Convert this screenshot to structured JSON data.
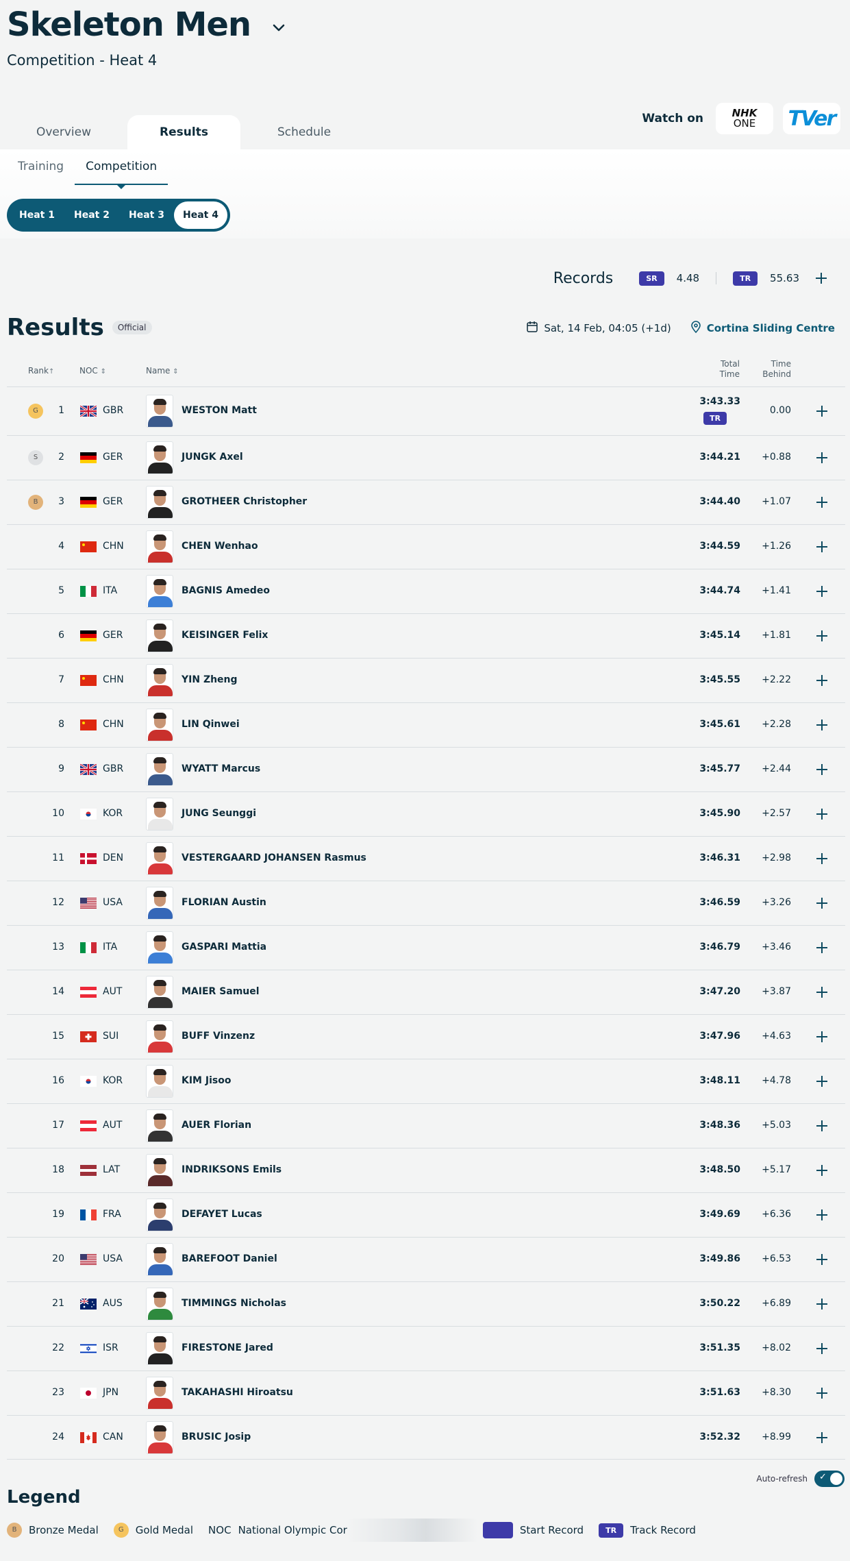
{
  "header": {
    "event_title": "Skeleton Men",
    "subtitle": "Competition - Heat 4"
  },
  "top_tabs": [
    {
      "label": "Overview",
      "active": false
    },
    {
      "label": "Results",
      "active": true
    },
    {
      "label": "Schedule",
      "active": false
    }
  ],
  "watch": {
    "label": "Watch on",
    "nhk_line1": "NHK",
    "nhk_line2": "ONE",
    "tver": "TVer"
  },
  "sub_tabs": [
    {
      "label": "Training",
      "active": false
    },
    {
      "label": "Competition",
      "active": true
    }
  ],
  "heats": [
    {
      "label": "Heat 1",
      "active": false
    },
    {
      "label": "Heat 2",
      "active": false
    },
    {
      "label": "Heat 3",
      "active": false
    },
    {
      "label": "Heat 4",
      "active": true
    }
  ],
  "records": {
    "title": "Records",
    "sr_badge": "SR",
    "sr_value": "4.48",
    "tr_badge": "TR",
    "tr_value": "55.63"
  },
  "results": {
    "title": "Results",
    "status": "Official",
    "date": "Sat, 14 Feb, 04:05 (+1d)",
    "venue": "Cortina Sliding Centre"
  },
  "table_header": {
    "rank": "Rank",
    "noc": "NOC",
    "name": "Name",
    "total_line1": "Total",
    "total_line2": "Time",
    "behind_line1": "Time",
    "behind_line2": "Behind"
  },
  "rows": [
    {
      "medal": "G",
      "rank": "1",
      "noc": "GBR",
      "name": "WESTON Matt",
      "total": "3:43.33",
      "record": "TR",
      "behind": "0.00",
      "colors": [
        "#3b5a8c"
      ]
    },
    {
      "medal": "S",
      "rank": "2",
      "noc": "GER",
      "name": "JUNGK Axel",
      "total": "3:44.21",
      "behind": "+0.88",
      "colors": [
        "#222"
      ]
    },
    {
      "medal": "B",
      "rank": "3",
      "noc": "GER",
      "name": "GROTHEER Christopher",
      "total": "3:44.40",
      "behind": "+1.07",
      "colors": [
        "#222"
      ]
    },
    {
      "rank": "4",
      "noc": "CHN",
      "name": "CHEN Wenhao",
      "total": "3:44.59",
      "behind": "+1.26",
      "colors": [
        "#c9302c"
      ]
    },
    {
      "rank": "5",
      "noc": "ITA",
      "name": "BAGNIS Amedeo",
      "total": "3:44.74",
      "behind": "+1.41",
      "colors": [
        "#3d7fd6"
      ]
    },
    {
      "rank": "6",
      "noc": "GER",
      "name": "KEISINGER Felix",
      "total": "3:45.14",
      "behind": "+1.81",
      "colors": [
        "#222"
      ]
    },
    {
      "rank": "7",
      "noc": "CHN",
      "name": "YIN Zheng",
      "total": "3:45.55",
      "behind": "+2.22",
      "colors": [
        "#c9302c"
      ]
    },
    {
      "rank": "8",
      "noc": "CHN",
      "name": "LIN Qinwei",
      "total": "3:45.61",
      "behind": "+2.28",
      "colors": [
        "#c9302c"
      ]
    },
    {
      "rank": "9",
      "noc": "GBR",
      "name": "WYATT Marcus",
      "total": "3:45.77",
      "behind": "+2.44",
      "colors": [
        "#3b5a8c"
      ]
    },
    {
      "rank": "10",
      "noc": "KOR",
      "name": "JUNG Seunggi",
      "total": "3:45.90",
      "behind": "+2.57",
      "colors": [
        "#e8e8e8"
      ]
    },
    {
      "rank": "11",
      "noc": "DEN",
      "name": "VESTERGAARD JOHANSEN Rasmus",
      "total": "3:46.31",
      "behind": "+2.98",
      "colors": [
        "#d8383a"
      ]
    },
    {
      "rank": "12",
      "noc": "USA",
      "name": "FLORIAN Austin",
      "total": "3:46.59",
      "behind": "+3.26",
      "colors": [
        "#3567b8"
      ]
    },
    {
      "rank": "13",
      "noc": "ITA",
      "name": "GASPARI Mattia",
      "total": "3:46.79",
      "behind": "+3.46",
      "colors": [
        "#3d7fd6"
      ]
    },
    {
      "rank": "14",
      "noc": "AUT",
      "name": "MAIER Samuel",
      "total": "3:47.20",
      "behind": "+3.87",
      "colors": [
        "#333"
      ]
    },
    {
      "rank": "15",
      "noc": "SUI",
      "name": "BUFF Vinzenz",
      "total": "3:47.96",
      "behind": "+4.63",
      "colors": [
        "#d8383a"
      ]
    },
    {
      "rank": "16",
      "noc": "KOR",
      "name": "KIM Jisoo",
      "total": "3:48.11",
      "behind": "+4.78",
      "colors": [
        "#e8e8e8"
      ]
    },
    {
      "rank": "17",
      "noc": "AUT",
      "name": "AUER Florian",
      "total": "3:48.36",
      "behind": "+5.03",
      "colors": [
        "#333"
      ]
    },
    {
      "rank": "18",
      "noc": "LAT",
      "name": "INDRIKSONS Emils",
      "total": "3:48.50",
      "behind": "+5.17",
      "colors": [
        "#5a2a2a"
      ]
    },
    {
      "rank": "19",
      "noc": "FRA",
      "name": "DEFAYET Lucas",
      "total": "3:49.69",
      "behind": "+6.36",
      "colors": [
        "#2c3e6e"
      ]
    },
    {
      "rank": "20",
      "noc": "USA",
      "name": "BAREFOOT Daniel",
      "total": "3:49.86",
      "behind": "+6.53",
      "colors": [
        "#3567b8"
      ]
    },
    {
      "rank": "21",
      "noc": "AUS",
      "name": "TIMMINGS Nicholas",
      "total": "3:50.22",
      "behind": "+6.89",
      "colors": [
        "#2e8a3e"
      ]
    },
    {
      "rank": "22",
      "noc": "ISR",
      "name": "FIRESTONE Jared",
      "total": "3:51.35",
      "behind": "+8.02",
      "colors": [
        "#222"
      ]
    },
    {
      "rank": "23",
      "noc": "JPN",
      "name": "TAKAHASHI Hiroatsu",
      "total": "3:51.63",
      "behind": "+8.30",
      "colors": [
        "#c9302c"
      ]
    },
    {
      "rank": "24",
      "noc": "CAN",
      "name": "BRUSIC Josip",
      "total": "3:52.32",
      "behind": "+8.99",
      "colors": [
        "#d8383a"
      ]
    }
  ],
  "autorefresh": {
    "label": "Auto-refresh",
    "enabled": true
  },
  "legend": {
    "title": "Legend",
    "bronze_badge": "B",
    "bronze": "Bronze Medal",
    "gold_badge": "G",
    "gold": "Gold Medal",
    "noc_abbr": "NOC",
    "noc": "National Olympic Cor",
    "start_record": "Start Record",
    "tr_badge": "TR",
    "track_record": "Track Record"
  },
  "icons": [
    "chevron-down-icon",
    "calendar-icon",
    "location-pin-icon",
    "plus-icon",
    "sort-icon",
    "check-icon"
  ],
  "colors": {
    "accent": "#0d5a75",
    "record_badge": "#3d3aa8",
    "text": "#0d2b3a"
  }
}
